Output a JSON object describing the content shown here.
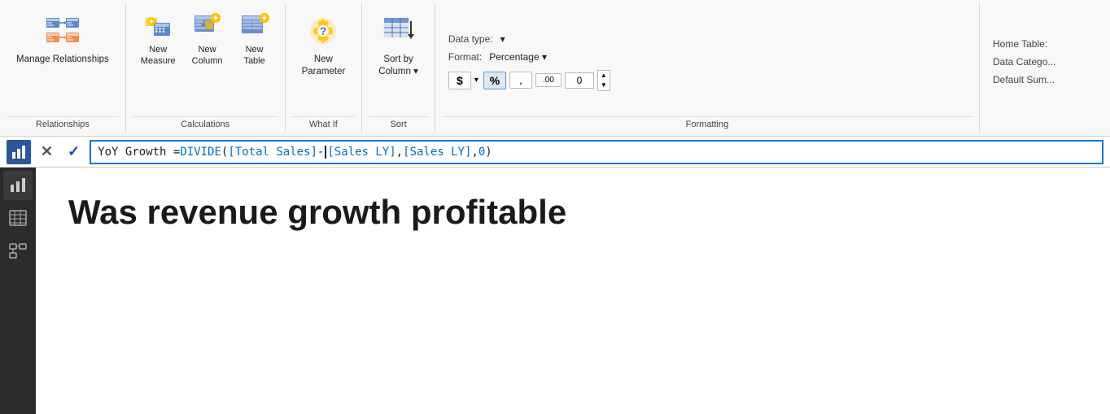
{
  "ribbon": {
    "groups": [
      {
        "id": "relationships",
        "label": "Relationships",
        "items": [
          {
            "id": "manage-relationships",
            "label": "Manage\nRelationships",
            "icon": "manage-relationships-icon",
            "size": "large"
          }
        ]
      },
      {
        "id": "calculations",
        "label": "Calculations",
        "items": [
          {
            "id": "new-measure",
            "label": "New\nMeasure",
            "icon": "new-measure-icon",
            "size": "small"
          },
          {
            "id": "new-column",
            "label": "New\nColumn",
            "icon": "new-column-icon",
            "size": "small"
          },
          {
            "id": "new-table",
            "label": "New\nTable",
            "icon": "new-table-icon",
            "size": "small"
          }
        ]
      },
      {
        "id": "what-if",
        "label": "What If",
        "items": [
          {
            "id": "new-parameter",
            "label": "New\nParameter",
            "icon": "new-parameter-icon",
            "size": "large"
          }
        ]
      },
      {
        "id": "sort",
        "label": "Sort",
        "items": [
          {
            "id": "sort-by-column",
            "label": "Sort by\nColumn",
            "icon": "sort-by-column-icon",
            "size": "large"
          }
        ]
      }
    ],
    "formatting": {
      "data_type_label": "Data type:",
      "format_label": "Format:",
      "format_value": "Percentage",
      "format_group_label": "Formatting",
      "dollar_btn": "$",
      "percent_btn": "%",
      "comma_btn": ",",
      "decimal_btn": ".00",
      "decimal_value": "0",
      "home_table_label": "Home Table:",
      "data_category_label": "Data Catego...",
      "default_sum_label": "Default Sum..."
    }
  },
  "formula_bar": {
    "cancel_symbol": "✕",
    "accept_symbol": "✓",
    "formula_text": "YoY Growth = DIVIDE( [Total Sales] - [Sales LY], [Sales LY], 0 )"
  },
  "sidebar": {
    "items": [
      {
        "id": "report-view",
        "icon": "chart-bar-icon",
        "active": true
      },
      {
        "id": "table-view",
        "icon": "table-icon",
        "active": false
      },
      {
        "id": "model-view",
        "icon": "model-icon",
        "active": false
      }
    ]
  },
  "main": {
    "title": "Was revenue growth profitable"
  }
}
